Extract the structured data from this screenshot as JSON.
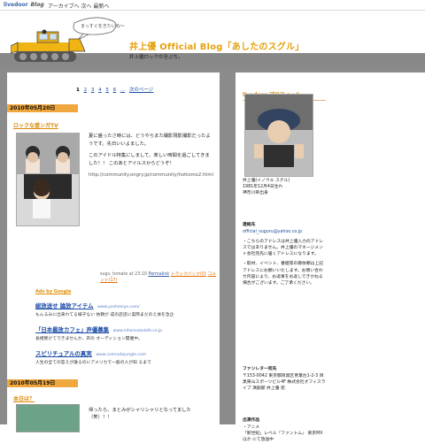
{
  "topbar": {
    "brand": "livedoor",
    "brand_sub": "Blog",
    "nav": "アーカイブへ  次へ  最新へ"
  },
  "header": {
    "title": "井上優  Official Blog「あしたのスグル」",
    "subtitle": "井上優ロックの全ぶち。",
    "speech": "まっすぐをきたいね〜"
  },
  "pagination": {
    "pages": [
      "1",
      "2",
      "3",
      "4",
      "5",
      "6",
      "..."
    ],
    "current": "1",
    "next": "次のページ"
  },
  "entry1": {
    "date": "2010年05月20日",
    "title": "ロックな盛ンガTV",
    "paragraph1": "夏に盛ったさ時には、どうやらまた撮影現影撮影だったようです。先日いいよました。",
    "paragraph2": "このアイドル特集にしまして、楽しい時間を過ごしてきました！！ このあとアイルスからどうぞ！",
    "url": "http://community.ongry.jp/community/hottomo2.html",
    "meta_author": "sugu_tomato at 23:10",
    "meta_permalink": "Permalink",
    "meta_trackback": "トラックバック(0)",
    "meta_comments": "コメント(17)"
  },
  "ads": {
    "label": "Ads by Google",
    "items": [
      {
        "title": "総放送せ 論放アイテム",
        "url": "www.yoshimiya.com/",
        "desc": "もんるみに出来れてる様子ない 依頼が 成の店店に実際まだのえ体を急企"
      },
      {
        "title": "「日本最放カフェ」声優募集",
        "url": "www.nihonsokolofe.co.jp",
        "desc": "長相受けてできませんか、声の オーディション開催中。"
      },
      {
        "title": "スピリチュアルの真実",
        "url": "www.comradejungle.com",
        "desc": "人生の全ての答えが誰るのにアメリカで一般の人が知 るまで"
      }
    ]
  },
  "entry2": {
    "date": "2010年05月19日",
    "title": "本日は？",
    "body": "帰ったら、まとみがシャリシャリとなってました（笑）！！"
  },
  "sidebar": {
    "profile_heading": "livedoor プロフィール",
    "profile_name": "井上優(イノウエ スグル)",
    "profile_birth": "1981年12月4日生れ",
    "profile_home": "神奈川県出身",
    "contact_label": "連絡先",
    "contact_email": "official_suguru@yahoo.co.jp",
    "contact_note1": "・こちらのアドレスは井上優入力のアドレスではありません。井上優のマネージメント会社宛先に届くアドレスになります。",
    "contact_note2": "・取材、イベント、番組等の御依頼は上記アドレスにお願いいたします。お問い合わせ内容により、お返事をお返しできかねる場合がございます。ご了承ください。",
    "fanletter_label": "ファンレター宛先",
    "fanletter_addr": "〒153-0042 東京都目黒区青葉台1-2-3 目黒東山スポーツビル4F 株式会社オフィスライブ 演劇部 井上優 宛",
    "works_label": "出演作品",
    "works_1": "・アニメ",
    "works_2": "「新世紀」レベル『ファントム』 東京MX ほか にて放送中"
  },
  "colors": {
    "accent": "#f0a73e",
    "title": "#e6a10b",
    "frame": "#8b8b8b",
    "link": "#1a4aa7"
  }
}
